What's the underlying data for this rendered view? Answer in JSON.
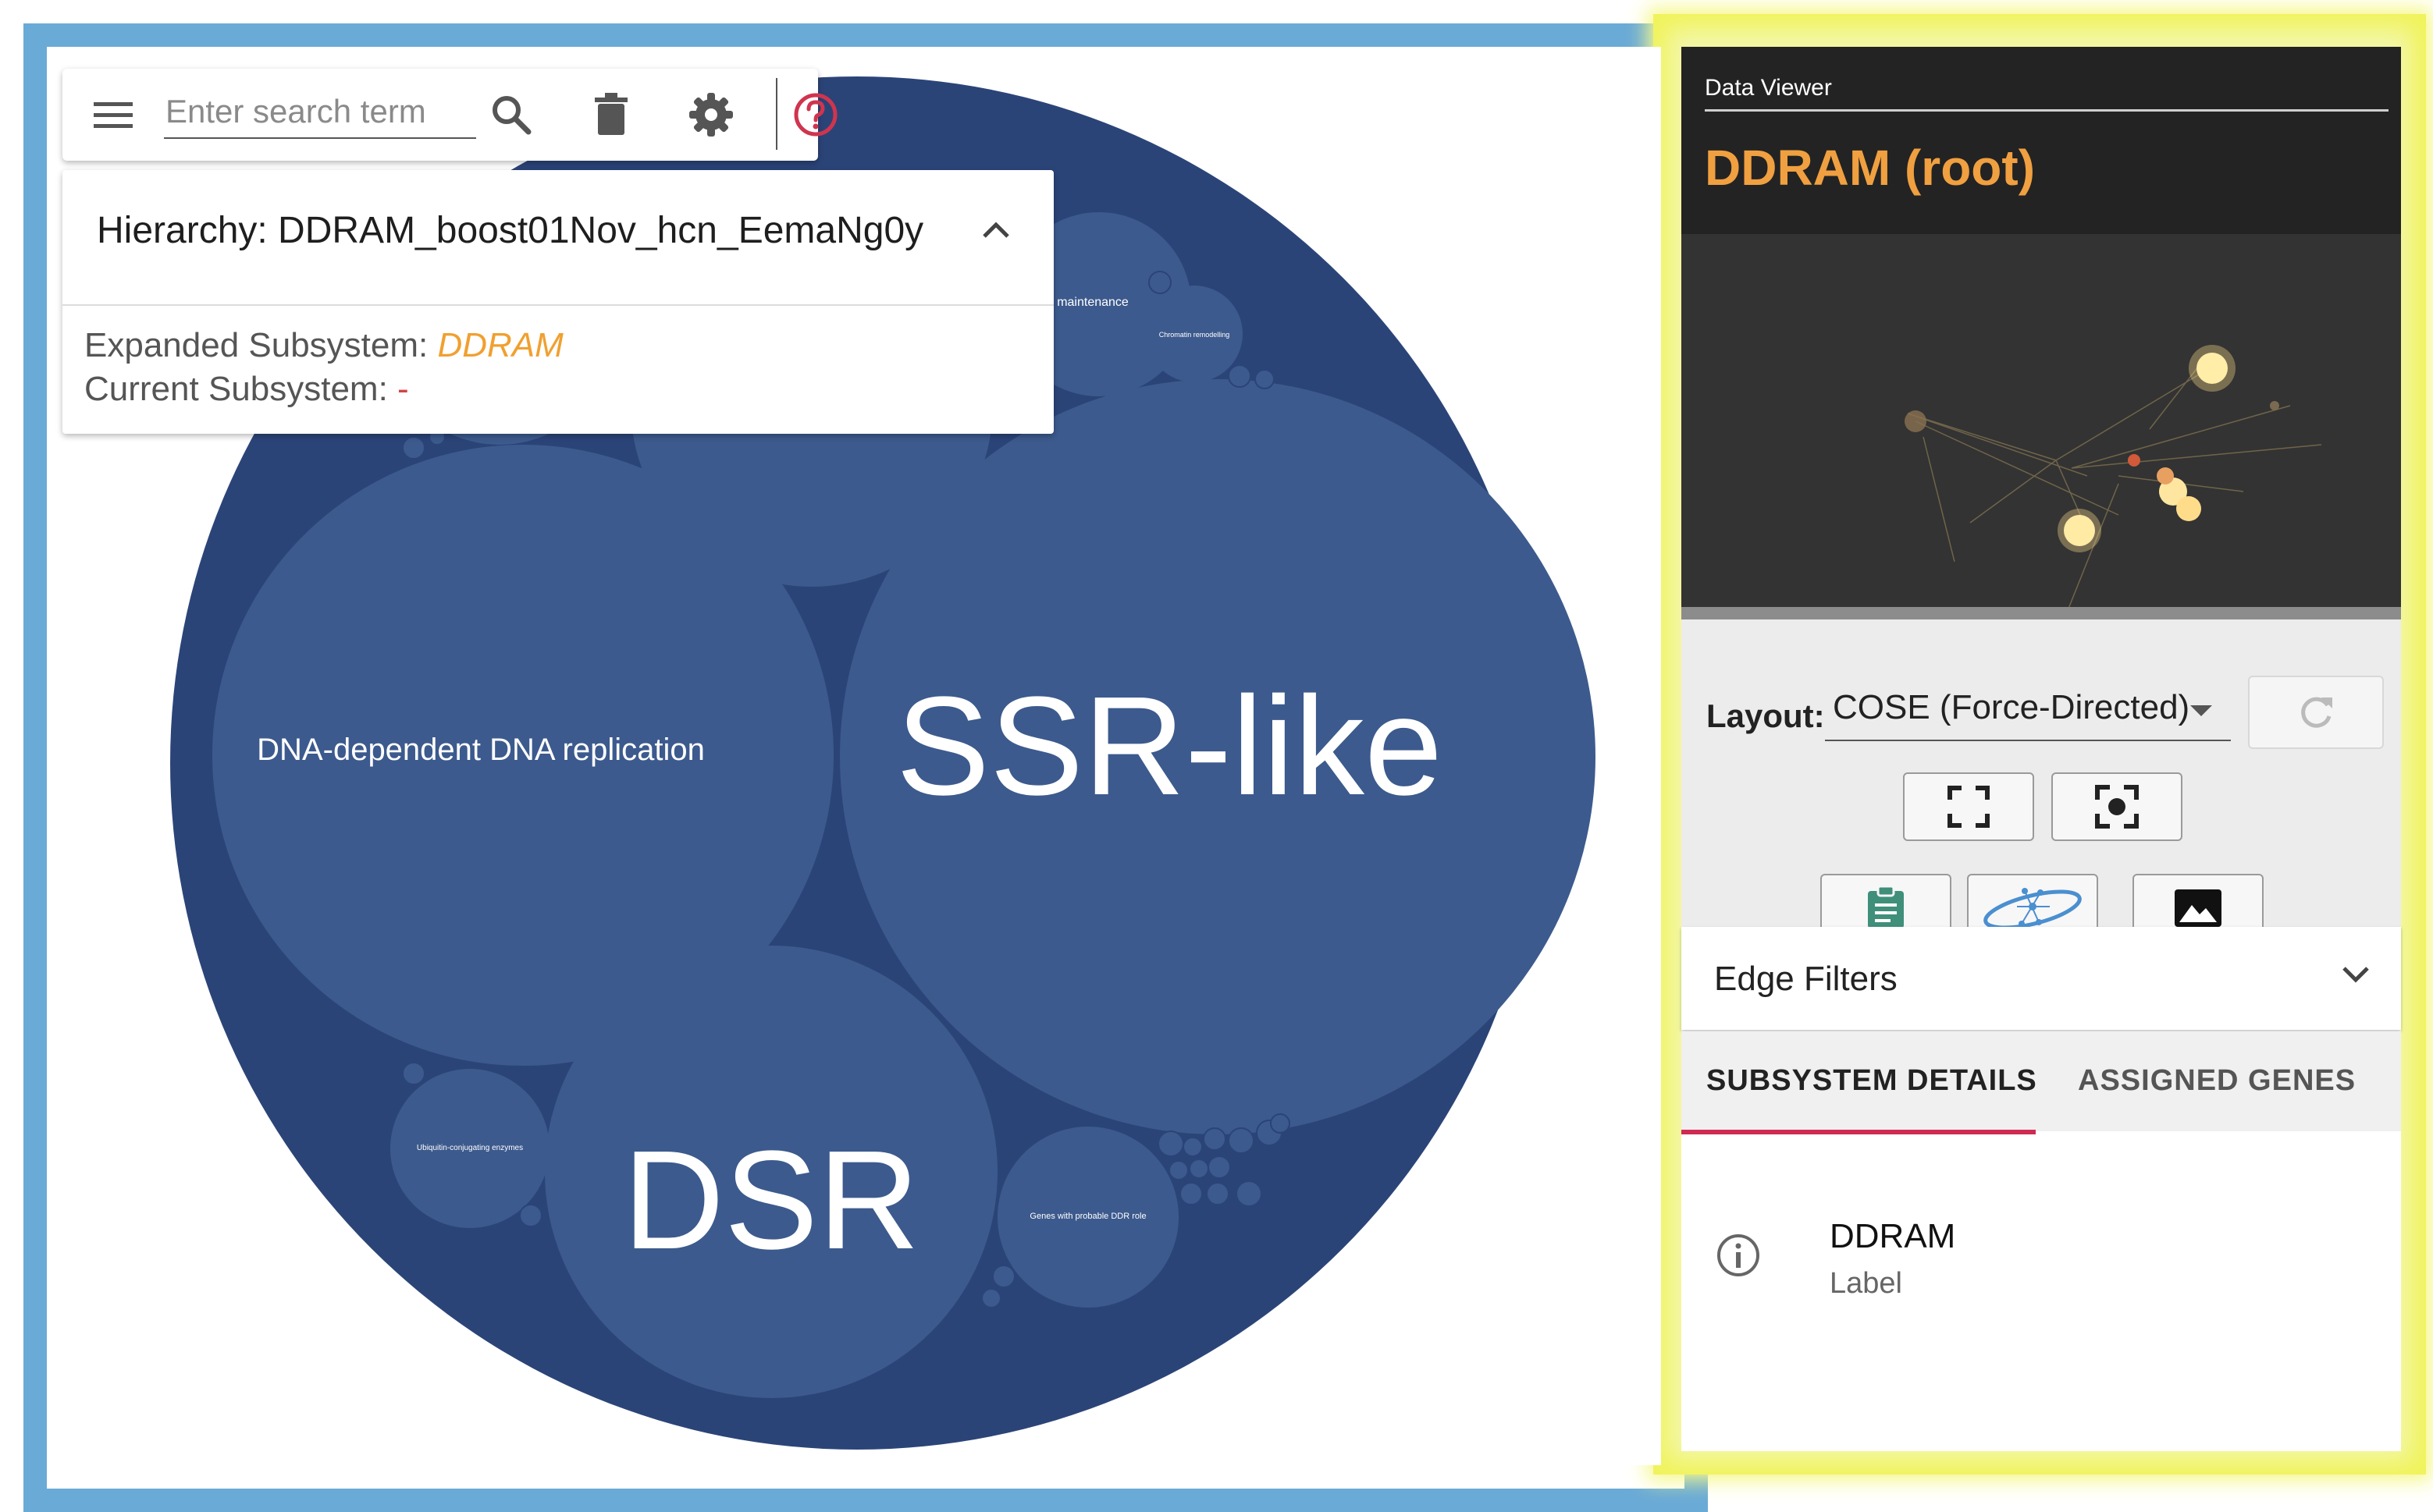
{
  "toolbar": {
    "search_placeholder": "Enter search term",
    "icons": [
      "menu-icon",
      "search-icon",
      "trash-icon",
      "gear-icon",
      "help-icon"
    ]
  },
  "hierarchy_panel": {
    "title": "Hierarchy: DDRAM_boost01Nov_hcn_EemaNg0y",
    "expanded_label": "Expanded Subsystem: ",
    "expanded_value": "DDRAM",
    "current_label": "Current Subsystem: ",
    "current_value": "-"
  },
  "pack": {
    "colors": {
      "outer": "#2b4478",
      "inner": "#3c5a8d",
      "border": "#6aaad6"
    },
    "labels": {
      "ssr": "SSR-like",
      "dsr": "DSR",
      "dna_replication": "DNA-dependent DNA replication",
      "maintenance": "maintenance",
      "chromatin": "Chromatin remodelling",
      "ubiquitin": "Ubiquitin-conjugating enzymes",
      "probable_ddr": "Genes with probable DDR role"
    }
  },
  "viewer": {
    "caption": "Data Viewer",
    "title": "DDRAM (root)",
    "title_color": "#f0a040",
    "layout_label": "Layout:",
    "layout_value": "COSE (Force-Directed)",
    "buttons": [
      "fit-icon",
      "center-focus-icon",
      "clipboard-icon",
      "network-icon",
      "image-icon",
      "refresh-icon"
    ],
    "edge_filters_label": "Edge Filters",
    "tabs": [
      {
        "label": "SUBSYSTEM DETAILS",
        "active": true
      },
      {
        "label": "ASSIGNED GENES",
        "active": false
      }
    ],
    "detail": {
      "name": "DDRAM",
      "sub": "Label"
    }
  }
}
